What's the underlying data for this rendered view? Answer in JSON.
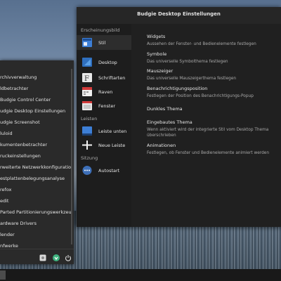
{
  "window": {
    "title": "Budgie Desktop Einstellungen"
  },
  "sidebar": {
    "section_appearance": "Erscheinungsbild",
    "section_panels": "Leisten",
    "section_session": "Sitzung",
    "items": [
      {
        "label": "Stil",
        "icon": "style-icon"
      },
      {
        "label": "Desktop",
        "icon": "desktop-icon"
      },
      {
        "label": "Schriftarten",
        "icon": "fonts-icon"
      },
      {
        "label": "Raven",
        "icon": "raven-icon"
      },
      {
        "label": "Fenster",
        "icon": "window-icon"
      },
      {
        "label": "Leiste unten",
        "icon": "panel-icon"
      },
      {
        "label": "Neue Leiste",
        "icon": "add-icon"
      },
      {
        "label": "Autostart",
        "icon": "autostart-icon"
      }
    ]
  },
  "options": [
    {
      "title": "Widgets",
      "desc": "Aussehen der Fenster- und Bedienelemente festlegen"
    },
    {
      "title": "Symbole",
      "desc": "Das universelle Symbolthema festlegen"
    },
    {
      "title": "Mauszeiger",
      "desc": "Das universelle Mauszeigerthema festlegen"
    },
    {
      "title": "Benachrichtigungsposition",
      "desc": "Festlegen der Position des Benachrichtigungs-Popup"
    },
    {
      "title": "Dunkles Thema",
      "desc": ""
    },
    {
      "title": "Eingebautes Thema",
      "desc": "Wenn aktiviert wird der integrierte Stil vom Desktop Thema überschrieben"
    },
    {
      "title": "Animationen",
      "desc": "Festlegen, ob Fenster und Bedienelemente animiert werden"
    }
  ],
  "menu": {
    "items": [
      "rchivverwaltung",
      "ldbetrachter",
      "Budgie Control Center",
      "udgie Desktop Einstellungen",
      "udgie Screenshot",
      "luloid",
      "kumentenbetrachter",
      "ruckeinstellungen",
      "rweiterte Netzwerkkonfiguration",
      "estplattenbelegungsanalyse",
      "refox",
      "edit",
      "Parted Partitionierungswerkzeug",
      "ardware Drivers",
      "lender",
      "nfwerke"
    ]
  },
  "colors": {
    "sidebar_selected": "#2d2d2d",
    "icon_blue": "#3d7fd6",
    "icon_red": "#d23b3b",
    "accent_green": "#3fb37f"
  }
}
